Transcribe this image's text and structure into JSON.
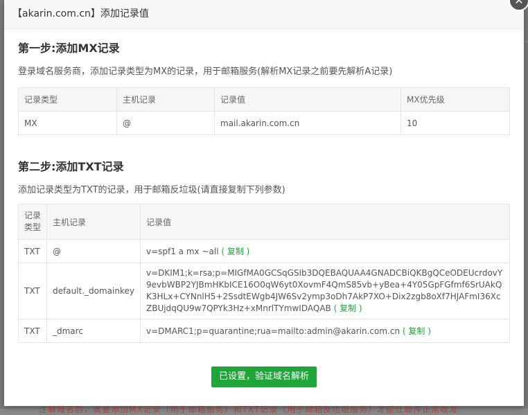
{
  "dialog": {
    "title": "【akarin.com.cn】添加记录值",
    "close_glyph": "✕"
  },
  "mx_section": {
    "title": "第一步:添加MX记录",
    "desc": "登录域名服务商，添加记录类型为MX的记录，用于邮箱服务(解析MX记录之前要先解析A记录)",
    "headers": [
      "记录类型",
      "主机记录",
      "记录值",
      "MX优先级"
    ],
    "row": {
      "type": "MX",
      "host": "@",
      "value": "mail.akarin.com.cn",
      "priority": "10"
    }
  },
  "txt_section": {
    "title": "第二步:添加TXT记录",
    "desc": "添加记录类型为TXT的记录，用于邮箱反垃圾(请直接复制下列参数)",
    "headers": [
      "记录类型",
      "主机记录",
      "记录值"
    ],
    "rows": [
      {
        "type": "TXT",
        "host": "@",
        "value": "v=spf1 a mx ~all",
        "copy": "( 复制 )"
      },
      {
        "type": "TXT",
        "host": "default._domainkey",
        "value": "v=DKIM1;k=rsa;p=MIGfMA0GCSqGSIb3DQEBAQUAA4GNADCBiQKBgQCeODEUcrdovY9evbWBP2YJBmHKbICE16O0qW6yt0XovmF4QmS85vb+yBea+4Y05GpFGfmf6SrUAkQK3HLx+CYNnlH5+2SsdtEWgb4JW6Sv2ymp3oDh7AkP7XO+Dix2zgb8oXf7HJAFmI36XcZBUjdqQU9w7QPYk3Hz+xMnrlTYmwIDAQAB",
        "copy": "( 复制 )"
      },
      {
        "type": "TXT",
        "host": "_dmarc",
        "value": "v=DMARC1;p=quarantine;rua=mailto:admin@akarin.com.cn",
        "copy": "( 复制 )"
      }
    ]
  },
  "verify_button": "已设置，验证域名解析",
  "background_note": "注解域名后，需要添加MX记录（用于邮箱服务）和TXT记录（用于邮箱反垃圾服务）才能让邮件正常收发",
  "colors": {
    "accent": "#20a53a",
    "overlay": "#7c7c7c"
  }
}
